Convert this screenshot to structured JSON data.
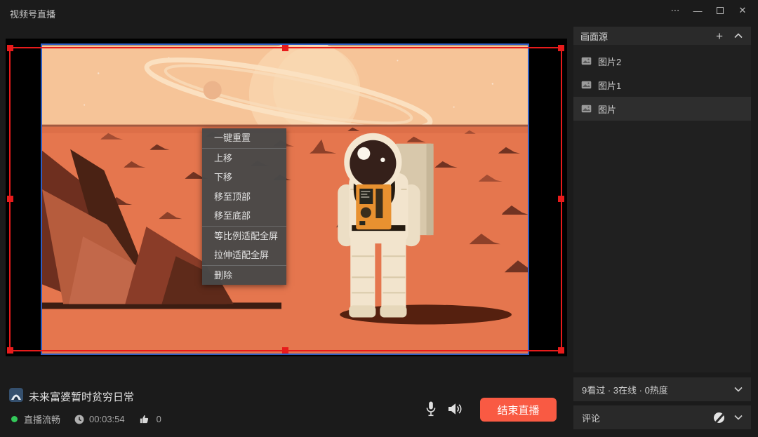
{
  "window": {
    "title": "视频号直播",
    "controls": {
      "more": "⋯",
      "minimize": "—",
      "close": "✕"
    }
  },
  "context_menu": {
    "items": [
      {
        "label": "一键重置"
      },
      {
        "label": "上移"
      },
      {
        "label": "下移"
      },
      {
        "label": "移至顶部"
      },
      {
        "label": "移至底部"
      },
      {
        "label": "等比例适配全屏"
      },
      {
        "label": "拉伸适配全屏"
      },
      {
        "label": "删除"
      }
    ]
  },
  "sidebar": {
    "header": {
      "title": "画面源",
      "add_label": "+"
    },
    "sources": [
      {
        "label": "图片2",
        "selected": false
      },
      {
        "label": "图片1",
        "selected": false
      },
      {
        "label": "图片",
        "selected": true
      }
    ]
  },
  "stats_panel": {
    "text": "9看过 · 3在线 · 0热度"
  },
  "comment_panel": {
    "label": "评论"
  },
  "stream_info": {
    "title": "未来富婆暂时贫穷日常",
    "status": "直播流畅",
    "duration": "00:03:54",
    "likes": "0"
  },
  "controls": {
    "end_button": "结束直播"
  },
  "icons": {
    "more": "more-icon",
    "minimize": "minimize-icon",
    "maximize": "maximize-icon",
    "close": "close-icon",
    "add": "plus-icon",
    "collapse": "chevron-up-icon",
    "expand": "chevron-down-icon",
    "image": "image-icon",
    "comment_mute": "comment-mute-icon",
    "clock": "clock-icon",
    "like": "thumb-up-icon",
    "mic": "microphone-icon",
    "speaker": "speaker-icon"
  },
  "colors": {
    "end_button": "#f95a43",
    "selection_red": "#e81b1b",
    "image_border_blue": "#2e5ec4",
    "live_green": "#33c85a",
    "panel_bg": "#292929",
    "canvas_bg": "#000000"
  }
}
